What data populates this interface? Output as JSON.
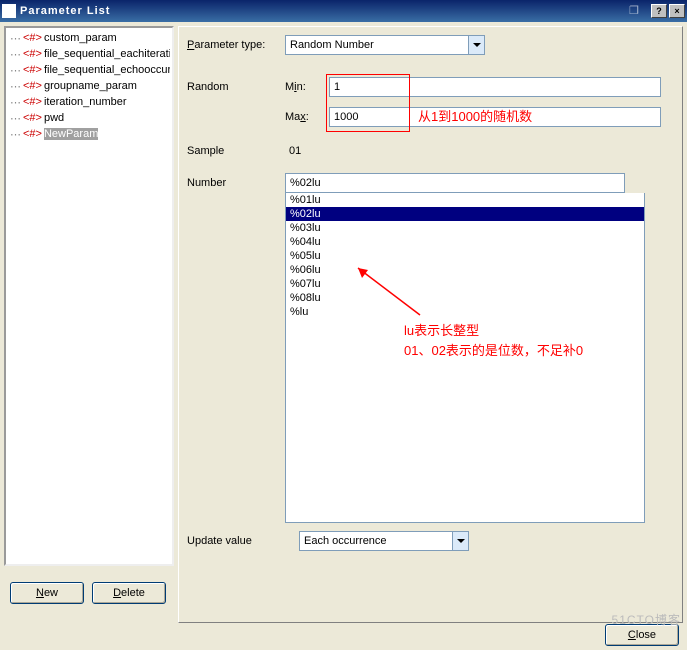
{
  "window": {
    "title": "Parameter List"
  },
  "tree_items": [
    {
      "label": "custom_param"
    },
    {
      "label": "file_sequential_eachiteration"
    },
    {
      "label": "file_sequential_echooccurr"
    },
    {
      "label": "groupname_param"
    },
    {
      "label": "iteration_number"
    },
    {
      "label": "pwd"
    },
    {
      "label": "NewParam",
      "selected": true
    }
  ],
  "param_type": {
    "label": "Parameter type:",
    "value": "Random Number"
  },
  "random": {
    "section_label": "Random",
    "min_label": "Min:",
    "min_value": "1",
    "max_label": "Max:",
    "max_value": "1000"
  },
  "sample": {
    "label": "Sample",
    "value": "01"
  },
  "number": {
    "label": "Number",
    "value": "%02lu",
    "options": [
      "%01lu",
      "%02lu",
      "%03lu",
      "%04lu",
      "%05lu",
      "%06lu",
      "%07lu",
      "%08lu",
      "%lu"
    ],
    "selected_index": 1
  },
  "update": {
    "label": "Update value",
    "value": "Each occurrence"
  },
  "buttons": {
    "new": "New",
    "delete": "Delete",
    "close": "Close"
  },
  "annotations": {
    "a1": "从1到1000的随机数",
    "a2_line1": "lu表示长整型",
    "a2_line2": "01、02表示的是位数，不足补0"
  },
  "watermark": "51CTO博客"
}
